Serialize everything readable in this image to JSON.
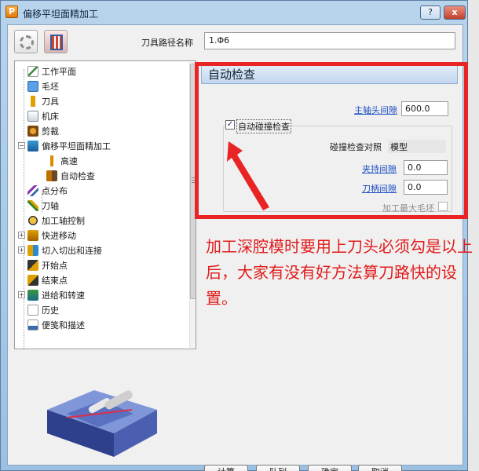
{
  "window": {
    "title": "偏移平坦面精加工",
    "app_icon_letter": "P",
    "help_label": "?",
    "close_label": "x"
  },
  "toolbar": {
    "path_name_label": "刀具路径名称",
    "path_name_value": "1.Φ6"
  },
  "tree": {
    "items": [
      {
        "label": "工作平面",
        "icon": "workplane-icon"
      },
      {
        "label": "毛坯",
        "icon": "block-icon"
      },
      {
        "label": "刀具",
        "icon": "tool-icon"
      },
      {
        "label": "机床",
        "icon": "machine-icon"
      },
      {
        "label": "剪裁",
        "icon": "limit-icon"
      },
      {
        "label": "偏移平坦面精加工",
        "icon": "finishing-icon"
      },
      {
        "label": "高速",
        "icon": "high-speed-icon"
      },
      {
        "label": "自动检查",
        "icon": "auto-check-icon"
      },
      {
        "label": "点分布",
        "icon": "point-distribution-icon"
      },
      {
        "label": "刀轴",
        "icon": "tool-axis-icon"
      },
      {
        "label": "加工轴控制",
        "icon": "axis-control-icon"
      },
      {
        "label": "快进移动",
        "icon": "rapid-move-icon"
      },
      {
        "label": "切入切出和连接",
        "icon": "leads-links-icon"
      },
      {
        "label": "开始点",
        "icon": "start-point-icon"
      },
      {
        "label": "结束点",
        "icon": "end-point-icon"
      },
      {
        "label": "进给和转速",
        "icon": "feeds-speeds-icon"
      },
      {
        "label": "历史",
        "icon": "history-icon"
      },
      {
        "label": "便笺和描述",
        "icon": "notes-icon"
      }
    ]
  },
  "panel": {
    "title": "自动检查",
    "spindle_clearance_label": "主轴头间隙",
    "spindle_clearance_value": "600.0",
    "auto_collision_label": "自动碰撞检查",
    "auto_collision_checked": "✓",
    "collision_ref_label": "碰撞检查对照",
    "collision_ref_value": "模型",
    "holder_clearance_label": "夹持间隙",
    "holder_clearance_value": "0.0",
    "shank_clearance_label": "刀柄间隙",
    "shank_clearance_value": "0.0",
    "max_stock_label": "加工最大毛坯"
  },
  "annotation": {
    "text": "加工深腔模时要用上刀头必须勾是以上后，大家有没有好方法算刀路快的设置。"
  },
  "buttons": {
    "calculate": "计算",
    "queue": "队列",
    "ok": "确定",
    "cancel": "取消"
  },
  "colors": {
    "annotation_red": "#e21c1c",
    "link_blue": "#1d4ec2",
    "title_bar": "#b8d4ec"
  }
}
